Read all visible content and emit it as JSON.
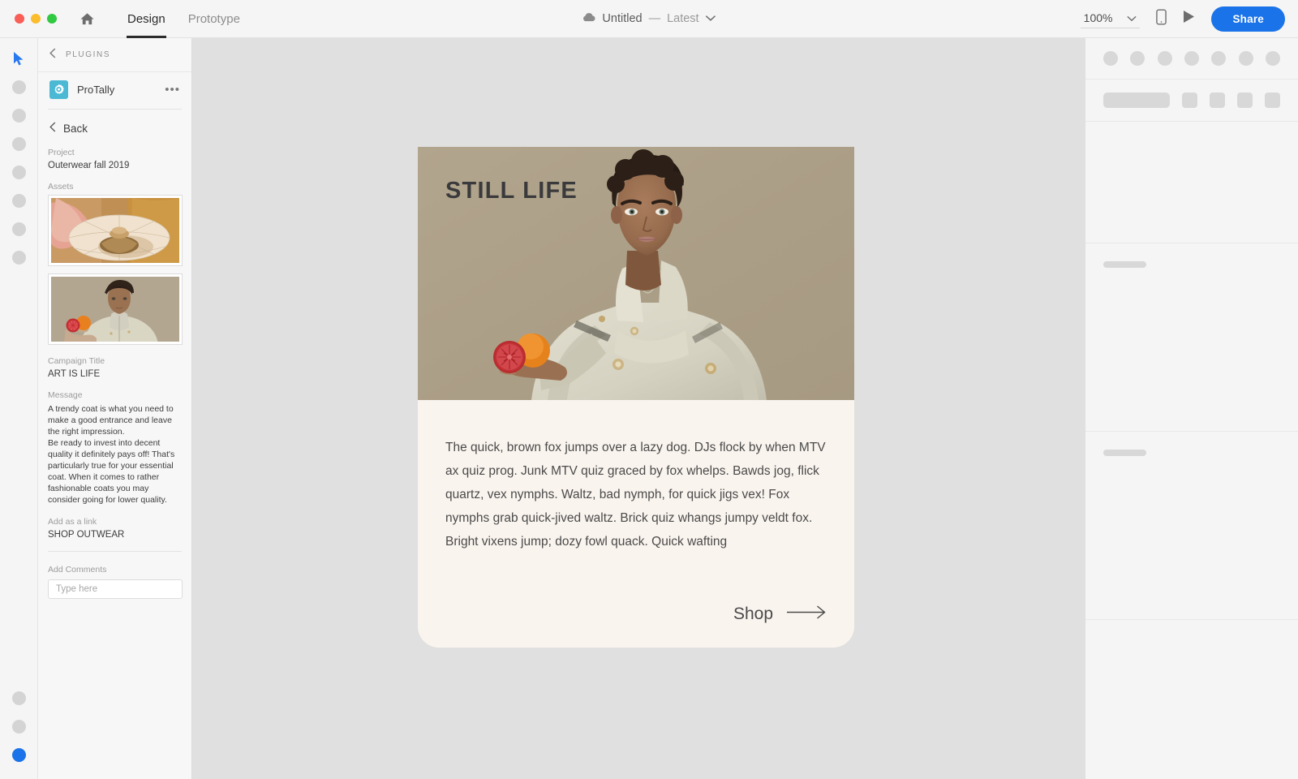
{
  "window": {
    "traffic_lights": [
      "close",
      "minimize",
      "maximize"
    ],
    "home_icon": "home-icon"
  },
  "topbar": {
    "tabs": [
      {
        "label": "Design",
        "active": true
      },
      {
        "label": "Prototype",
        "active": false
      }
    ],
    "document": {
      "cloud_icon": "cloud-icon",
      "title": "Untitled",
      "separator": "—",
      "version": "Latest",
      "chevron": "chevron-down-icon"
    },
    "zoom": {
      "level": "100%",
      "chevron": "chevron-down-icon"
    },
    "present_icon": "play-icon",
    "device_icon": "mobile-device-icon",
    "share_label": "Share"
  },
  "left_rail": {
    "tools": [
      {
        "name": "cursor-tool",
        "type": "cursor",
        "active": true
      },
      {
        "name": "tool-2",
        "type": "blob"
      },
      {
        "name": "tool-3",
        "type": "blob"
      },
      {
        "name": "tool-4",
        "type": "blob"
      },
      {
        "name": "tool-5",
        "type": "blob"
      },
      {
        "name": "tool-6",
        "type": "blob"
      },
      {
        "name": "tool-7",
        "type": "blob"
      },
      {
        "name": "tool-8",
        "type": "blob"
      }
    ],
    "bottom_tools": [
      {
        "name": "bottom-tool-1",
        "type": "blob"
      },
      {
        "name": "bottom-tool-2",
        "type": "blob"
      },
      {
        "name": "bottom-tool-3",
        "type": "blob",
        "accent": true
      }
    ]
  },
  "panel": {
    "breadcrumb_back_icon": "chevron-left-icon",
    "breadcrumb_label": "PLUGINS",
    "plugin": {
      "icon": "protally-gear-icon",
      "name": "ProTally",
      "more_icon": "more-horizontal-icon"
    },
    "back": {
      "icon": "chevron-left-icon",
      "label": "Back"
    },
    "fields": {
      "project_label": "Project",
      "project_value": "Outerwear fall 2019",
      "assets_label": "Assets",
      "campaign_title_label": "Campaign Title",
      "campaign_title_value": "ART IS LIFE",
      "message_label": "Message",
      "message_value": "A trendy coat is what you need to make a good entrance and leave the right impression.\nBe ready to invest into decent quality it definitely pays off! That's particularly true for your essential coat. When it comes to rather fashionable coats you may consider going for lower quality.",
      "link_label": "Add as a link",
      "link_value": "SHOP OUTWEAR"
    },
    "comments": {
      "label": "Add Comments",
      "placeholder": "Type here",
      "value": ""
    }
  },
  "card": {
    "photo_title": "STILL LIFE",
    "body_text": "The quick, brown fox jumps over a lazy dog. DJs flock by when MTV ax quiz prog. Junk MTV quiz graced by fox whelps. Bawds jog, flick quartz, vex nymphs. Waltz, bad nymph, for quick jigs vex! Fox nymphs grab quick-jived waltz. Brick quiz whangs jumpy veldt fox. Bright vixens jump; dozy fowl quack. Quick wafting",
    "cta_label": "Shop",
    "cta_icon": "arrow-right-icon"
  },
  "colors": {
    "accent_blue": "#1a73e8",
    "plugin_teal": "#4bb8d4",
    "card_cream": "#faf4ee",
    "photo_tan": "#ab9f88",
    "canvas_gray": "#e0e0e0"
  }
}
